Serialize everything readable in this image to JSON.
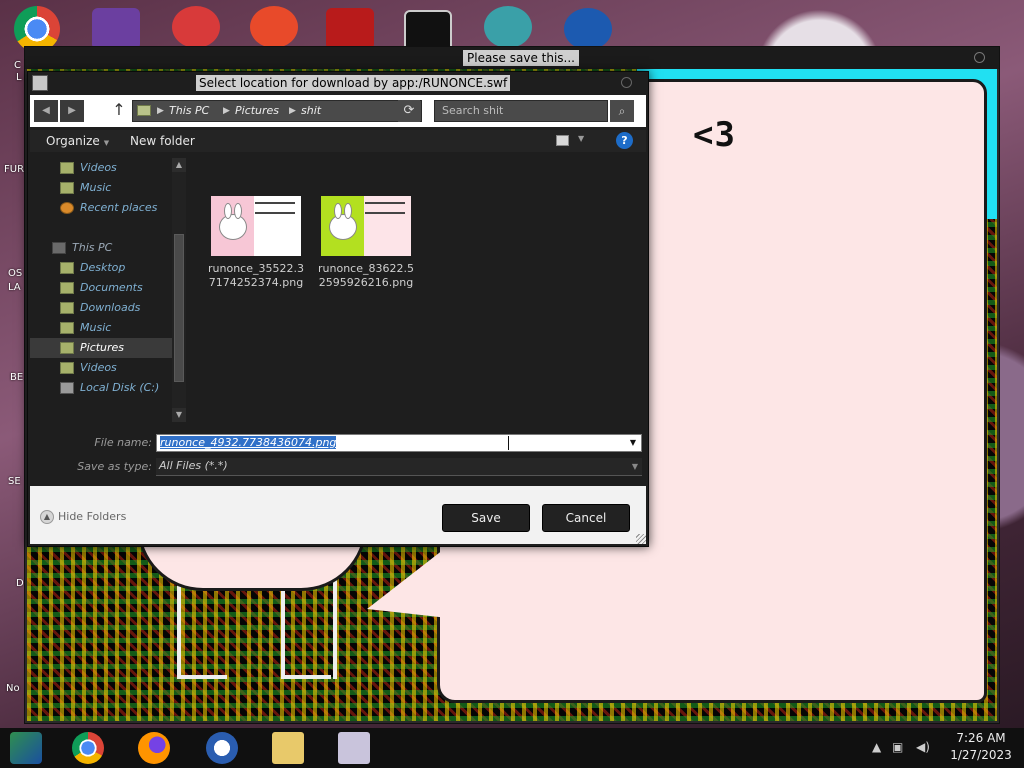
{
  "desktop": {
    "labels": [
      "C",
      "L",
      "FUR",
      "OS",
      "LA",
      "BE",
      "SE",
      "D",
      "No"
    ]
  },
  "app_window": {
    "title": "Please save this..."
  },
  "game": {
    "heart_text": "<3"
  },
  "dialog": {
    "title": "Select location for download by app:/RUNONCE.swf",
    "address": {
      "crumbs": [
        "This PC",
        "Pictures",
        "shit"
      ],
      "separator": "▶"
    },
    "search": {
      "placeholder": "Search shit"
    },
    "toolbar": {
      "organize": "Organize",
      "new_folder": "New folder",
      "help": "?"
    },
    "nav_pane": {
      "items": [
        {
          "label": "Videos"
        },
        {
          "label": "Music"
        },
        {
          "label": "Recent places"
        },
        {
          "label": "This PC"
        },
        {
          "label": "Desktop"
        },
        {
          "label": "Documents"
        },
        {
          "label": "Downloads"
        },
        {
          "label": "Music"
        },
        {
          "label": "Pictures",
          "selected": true
        },
        {
          "label": "Videos"
        },
        {
          "label": "Local Disk (C:)"
        }
      ]
    },
    "files": [
      {
        "name": "runonce_35522.37174252374.png"
      },
      {
        "name": "runonce_83622.52595926216.png"
      }
    ],
    "form": {
      "file_name_label": "File name:",
      "file_name_value": "runonce_4932.7738436074.png",
      "save_type_label": "Save as type:",
      "save_type_value": "All Files (*.*)"
    },
    "footer": {
      "hide_folders": "Hide Folders",
      "save": "Save",
      "cancel": "Cancel"
    }
  },
  "taskbar": {
    "time": "7:26 AM",
    "date": "1/27/2023"
  },
  "colors": {
    "selection_blue": "#3070c8",
    "help_blue": "#1d6cc8",
    "speech_pink": "#fde6e6",
    "cyan_border": "#21e0f2"
  }
}
